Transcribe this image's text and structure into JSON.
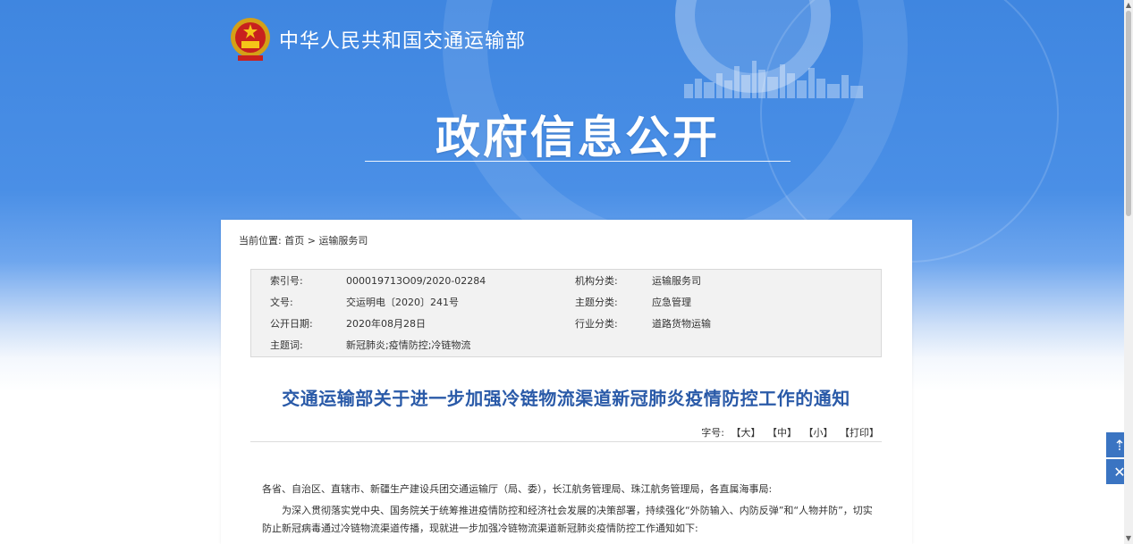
{
  "header": {
    "site_name": "中华人民共和国交通运输部",
    "hero_title": "政府信息公开"
  },
  "breadcrumb": {
    "prefix": "当前位置:",
    "home": "首页",
    "separator": ">",
    "current": "运输服务司"
  },
  "meta": {
    "rows": [
      {
        "k1": "索引号:",
        "v1": "000019713O09/2020-02284",
        "k2": "机构分类:",
        "v2": "运输服务司"
      },
      {
        "k1": "文号:",
        "v1": "交运明电〔2020〕241号",
        "k2": "主题分类:",
        "v2": "应急管理"
      },
      {
        "k1": "公开日期:",
        "v1": "2020年08月28日",
        "k2": "行业分类:",
        "v2": "道路货物运输"
      },
      {
        "k1": "主题词:",
        "v1": "新冠肺炎;疫情防控;冷链物流",
        "k2": "",
        "v2": ""
      }
    ]
  },
  "document": {
    "title": "交通运输部关于进一步加强冷链物流渠道新冠肺炎疫情防控工作的通知",
    "font_label": "字号:",
    "font_large": "【大】",
    "font_medium": "【中】",
    "font_small": "【小】",
    "print": "【打印】",
    "addressee": "各省、自治区、直辖市、新疆生产建设兵团交通运输厅（局、委），长江航务管理局、珠江航务管理局，各直属海事局:",
    "para1": "为深入贯彻落实党中央、国务院关于统筹推进疫情防控和经济社会发展的决策部署，持续强化“外防输入、内防反弹”和“人物并防”，切实防止新冠病毒通过冷链物流渠道传播，现就进一步加强冷链物流渠道新冠肺炎疫情防控工作通知如下:"
  },
  "side": {
    "top_icon": "back-to-top-icon",
    "close_icon": "close-icon",
    "top_glyph": "⇡",
    "close_glyph": "✕"
  },
  "colors": {
    "banner": "#4a8fe6",
    "title": "#2a5aa8",
    "side_button": "#3a74c2"
  }
}
